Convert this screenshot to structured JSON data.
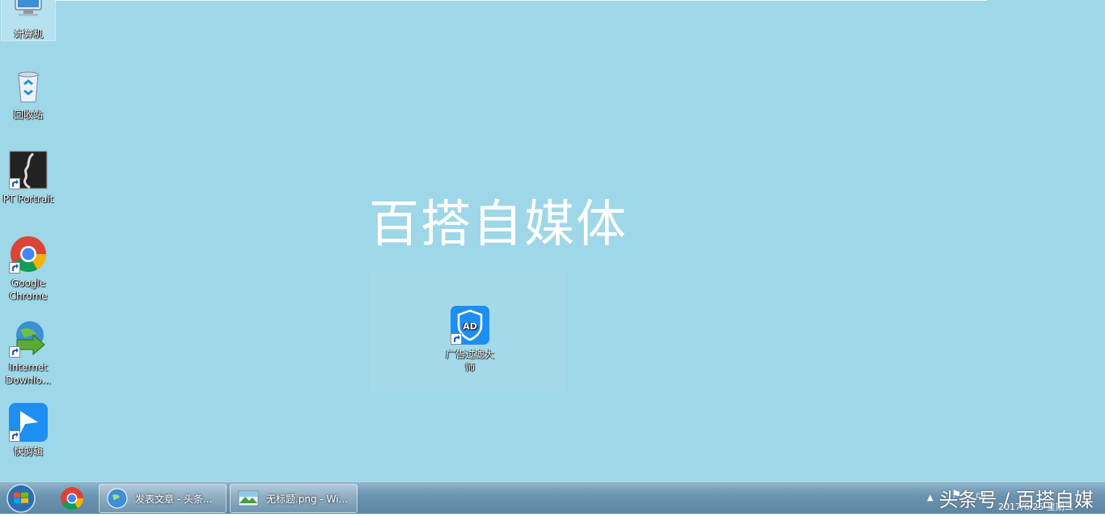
{
  "desktop": {
    "watermark": "百搭自媒体",
    "icons": [
      {
        "label": "计算机"
      },
      {
        "label": "回收站"
      },
      {
        "label": "PT Portrait"
      },
      {
        "label": "Google Chrome"
      },
      {
        "label": "Internet Downlo..."
      },
      {
        "label": "快剪辑"
      }
    ],
    "center_icon": {
      "label": "广告过滤大师",
      "badge": "AD"
    }
  },
  "taskbar": {
    "tasks": [
      {
        "label": "发表文章 - 头条..."
      },
      {
        "label": "无标题.png - Wi..."
      }
    ],
    "tray": {
      "clock_date": "2017/6/25 星期二",
      "overlay": "头条号 / 百搭自媒"
    }
  },
  "colors": {
    "desktop_bg": "#9ed7e8",
    "taskbar": "#6a93ae",
    "adblock_blue": "#1e8ff0"
  },
  "icons_semantic": [
    "computer-icon",
    "recycle-bin-icon",
    "pt-portrait-icon",
    "chrome-icon",
    "idm-icon",
    "kuaijianji-icon",
    "adblock-icon",
    "windows-start-icon"
  ]
}
